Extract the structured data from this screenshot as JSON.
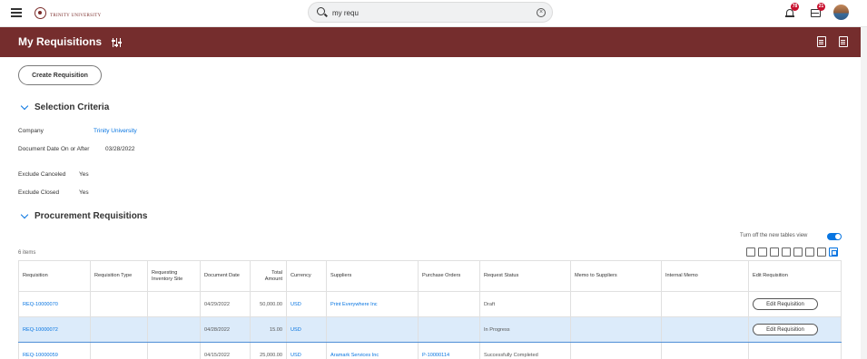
{
  "header": {
    "logo_text": "TRINITY UNIVERSITY",
    "search_value": "my requ",
    "notifications_count": "78",
    "inbox_count": "21"
  },
  "page": {
    "title": "My Requisitions",
    "create_button": "Create Requisition"
  },
  "selection": {
    "title": "Selection Criteria",
    "fields": [
      {
        "label": "Company",
        "value": "Trinity University"
      },
      {
        "label": "Document Date On or After",
        "value": "03/28/2022"
      },
      {
        "label": "Exclude Canceled",
        "value": "Yes"
      },
      {
        "label": "Exclude Closed",
        "value": "Yes"
      }
    ]
  },
  "procurement": {
    "title": "Procurement Requisitions",
    "toggle_label": "Turn off the new tables view",
    "item_count": "6 items",
    "columns": [
      "Requisition",
      "Requisition Type",
      "Requesting Inventory Site",
      "Document Date",
      "Total Amount",
      "Currency",
      "Suppliers",
      "Purchase Orders",
      "Request Status",
      "Memo to Suppliers",
      "Internal Memo",
      "Edit Requisition"
    ],
    "rows": [
      {
        "requisition": "REQ-10000070",
        "type": "",
        "site": "",
        "date": "04/29/2022",
        "amount": "50,000.00",
        "currency": "USD",
        "supplier": "Print Everywhere Inc",
        "po": "",
        "status": "Draft",
        "memo_sup": "",
        "memo_int": "",
        "edit": "Edit Requisition"
      },
      {
        "requisition": "REQ-10000072",
        "type": "",
        "site": "",
        "date": "04/28/2022",
        "amount": "15.00",
        "currency": "USD",
        "supplier": "",
        "po": "",
        "status": "In Progress",
        "memo_sup": "",
        "memo_int": "",
        "edit": "Edit Requisition"
      },
      {
        "requisition": "REQ-10000059",
        "type": "",
        "site": "",
        "date": "04/15/2022",
        "amount": "25,000.00",
        "currency": "USD",
        "supplier": "Aramark Services Inc",
        "po": "P-10000114",
        "status": "Successfully Completed",
        "memo_sup": "",
        "memo_int": "",
        "edit": ""
      }
    ]
  },
  "colors": {
    "brand": "#752d2d",
    "link": "#0875e1",
    "badge": "#c8102e",
    "selected_row": "#dcebfa"
  },
  "icons": [
    "hamburger-icon",
    "search-icon",
    "clear-icon",
    "bell-icon",
    "inbox-icon",
    "related-actions-icon",
    "export-excel-icon",
    "export-pdf-icon",
    "chevron-down-icon"
  ]
}
